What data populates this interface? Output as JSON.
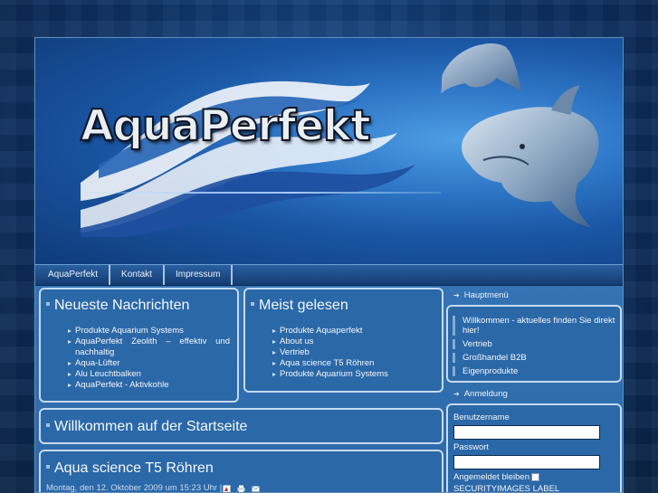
{
  "header": {
    "logo_text": "AquaPerfekt"
  },
  "menu": {
    "items": [
      "AquaPerfekt",
      "Kontakt",
      "Impressum"
    ]
  },
  "news": {
    "title": "Neueste Nachrichten",
    "items": [
      "Produkte Aquarium Systems",
      "AquaPerfekt Zeolith – effektiv und nachhaltig",
      "Aqua-Lüfter",
      "Alu Leuchtbalken",
      "AquaPerfekt - Aktivkohle"
    ]
  },
  "popular": {
    "title": "Meist gelesen",
    "items": [
      "Produkte Aquaperfekt",
      "About us",
      "Vertrieb",
      "Aqua science T5 Röhren",
      "Produkte Aquarium Systems"
    ]
  },
  "welcome": {
    "title": "Willkommen auf der Startseite"
  },
  "article": {
    "title": "Aqua science T5 Röhren",
    "meta": "Montag, den 12. Oktober 2009 um 15:23 Uhr |",
    "icons": [
      "pdf-icon",
      "print-icon",
      "email-icon"
    ]
  },
  "sidebar": {
    "main_menu_title": "Hauptmenü",
    "main_menu_items": [
      "Willkommen - aktuelles finden Sie direkt hier!",
      "Vertrieb",
      "Großhandel B2B",
      "Eigenprodukte"
    ],
    "login_title": "Anmeldung",
    "username_label": "Benutzername",
    "password_label": "Passwort",
    "remember_label": "Angemeldet bleiben",
    "security_label": "SECURITYIMAGES LABEL"
  },
  "colors": {
    "page_bg": "#0b2a52",
    "content_bg": "#2b68a8",
    "box_border": "#c4dbf0",
    "text": "#f4f8fc"
  }
}
